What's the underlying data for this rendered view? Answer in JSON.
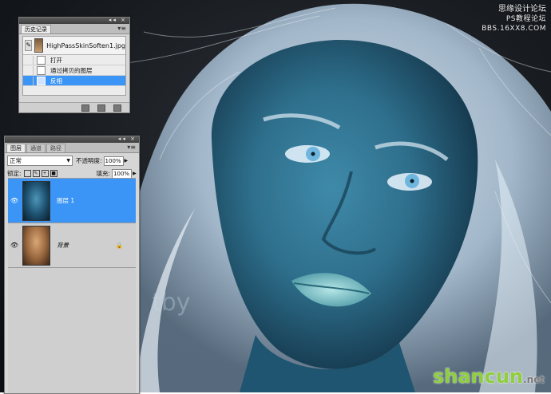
{
  "watermarks": {
    "top_line1": "思缘设计论坛",
    "top_line2": "PS教程论坛",
    "top_line3": "BBS.16XX8.COM",
    "faded_text": "tby",
    "bottom_brand": "shancun",
    "bottom_tld": ".net"
  },
  "history_panel": {
    "tab_label": "历史记录",
    "menu_icon": "menu-arrow-icon",
    "snapshot_name": "HighPassSkinSoften1.jpg",
    "steps": [
      {
        "label": "打开",
        "selected": false
      },
      {
        "label": "通过拷贝的图层",
        "selected": false
      },
      {
        "label": "反相",
        "selected": true
      }
    ]
  },
  "layers_panel": {
    "tabs": [
      "图层",
      "通道",
      "路径"
    ],
    "active_tab": "图层",
    "blend_mode": "正常",
    "opacity_label": "不透明度:",
    "opacity_value": "100%",
    "lock_label": "锁定:",
    "fill_label": "填充:",
    "fill_value": "100%",
    "layers": [
      {
        "name": "图层 1",
        "selected": true,
        "visible": true,
        "locked": false
      },
      {
        "name": "背景",
        "selected": false,
        "visible": true,
        "locked": true
      }
    ]
  },
  "colors": {
    "selection_blue": "#3b95f6",
    "panel_gray": "#d6d6d6"
  }
}
